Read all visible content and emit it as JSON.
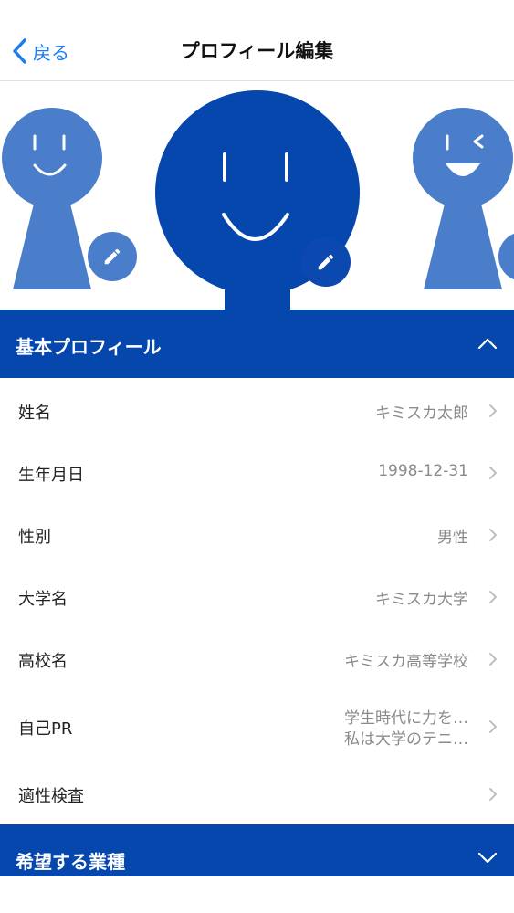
{
  "nav": {
    "back_label": "戻る",
    "title": "プロフィール編集"
  },
  "avatars": [
    {
      "color": "#4a7ecb",
      "expression": "smile"
    },
    {
      "color": "#0647ae",
      "expression": "smile",
      "selected": true
    },
    {
      "color": "#4a7ecb",
      "expression": "wink"
    }
  ],
  "sections": {
    "basic": {
      "title": "基本プロフィール",
      "state": "expanded"
    },
    "industry": {
      "title": "希望する業種",
      "state": "collapsed"
    }
  },
  "profile_rows": [
    {
      "label": "姓名",
      "value": "キミスカ太郎"
    },
    {
      "label": "生年月日",
      "value": "1998-12-31"
    },
    {
      "label": "性別",
      "value": "男性"
    },
    {
      "label": "大学名",
      "value": "キミスカ大学"
    },
    {
      "label": "高校名",
      "value": "キミスカ高等学校"
    },
    {
      "label": "自己PR",
      "value_line1": "学生時代に力を…",
      "value_line2": "私は大学のテニ…"
    },
    {
      "label": "適性検査",
      "value": ""
    }
  ],
  "colors": {
    "accent": "#1a7cf5",
    "section_bg": "#0647ae",
    "avatar_light": "#4a7ecb",
    "avatar_dark": "#0647ae"
  }
}
